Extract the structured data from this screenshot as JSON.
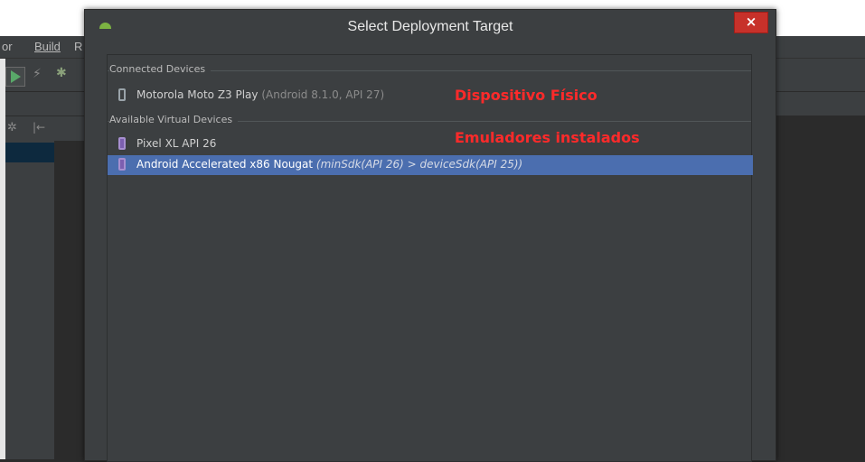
{
  "ide": {
    "menu": [
      {
        "label": "or"
      },
      {
        "label": "Build"
      },
      {
        "label": "R"
      }
    ]
  },
  "dialog": {
    "title": "Select Deployment Target",
    "close_label": "×",
    "sections": [
      {
        "label": "Connected Devices",
        "devices": [
          {
            "name": "Motorola Moto Z3 Play",
            "detail": " (Android 8.1.0, API 27)",
            "type": "physical",
            "selected": false
          }
        ]
      },
      {
        "label": "Available Virtual Devices",
        "devices": [
          {
            "name": "Pixel XL API 26",
            "detail": "",
            "type": "virtual",
            "selected": false
          },
          {
            "name": "Android Accelerated x86 Nougat",
            "detail": " (minSdk(API 26) > deviceSdk(API 25))",
            "type": "virtual",
            "selected": true
          }
        ]
      }
    ]
  },
  "annotations": {
    "physical": "Dispositivo Físico",
    "emulators": "Emuladores instalados"
  },
  "colors": {
    "annotation": "#ff2a2a",
    "selection": "#4b6eaf",
    "close": "#c7312a",
    "dialog_bg": "#3c3f41"
  },
  "icons": [
    "android-icon",
    "close-icon",
    "phone-icon",
    "emulator-icon",
    "run-icon",
    "debug-icon",
    "gear-icon"
  ]
}
